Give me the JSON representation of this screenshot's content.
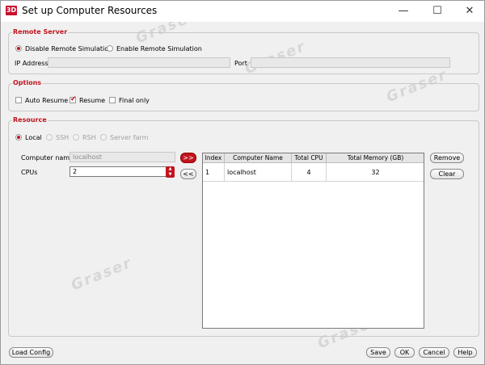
{
  "window": {
    "app_icon": "3D",
    "title": "Set up Computer Resources",
    "minimize_icon": "—",
    "maximize_icon": "☐",
    "close_icon": "✕"
  },
  "remote_server": {
    "legend": "Remote Server",
    "disable_label": "Disable Remote Simulation",
    "enable_label": "Enable Remote Simulation",
    "selected": "disable",
    "ip_label": "IP Address",
    "ip_value": "",
    "port_label": "Port",
    "port_value": ""
  },
  "options": {
    "legend": "Options",
    "auto_resume_label": "Auto Resume",
    "auto_resume": false,
    "resume_label": "Resume",
    "resume": true,
    "final_only_label": "Final only",
    "final_only": false
  },
  "resource": {
    "legend": "Resource",
    "types": [
      {
        "label": "Local",
        "selected": true,
        "enabled": true
      },
      {
        "label": "SSH",
        "selected": false,
        "enabled": false
      },
      {
        "label": "RSH",
        "selected": false,
        "enabled": false
      },
      {
        "label": "Server farm",
        "selected": false,
        "enabled": false
      }
    ],
    "computer_name_label": "Computer name",
    "computer_name_value": "localhost",
    "cpus_label": "CPUs",
    "cpus_value": "2",
    "add_label": ">>",
    "remove_arrow_label": "<<",
    "remove_label": "Remove",
    "clear_label": "Clear",
    "table": {
      "columns": [
        "Index",
        "Computer Name",
        "Total CPU",
        "Total Memory (GB)"
      ],
      "rows": [
        {
          "index": "1",
          "computer_name": "localhost",
          "total_cpu": "4",
          "total_memory": "32"
        }
      ]
    }
  },
  "footer": {
    "load_config_label": "Load Config",
    "save_label": "Save",
    "ok_label": "OK",
    "cancel_label": "Cancel",
    "help_label": "Help"
  },
  "watermark": "Graser",
  "colors": {
    "accent": "#c0141e",
    "background": "#f0f0f0"
  }
}
